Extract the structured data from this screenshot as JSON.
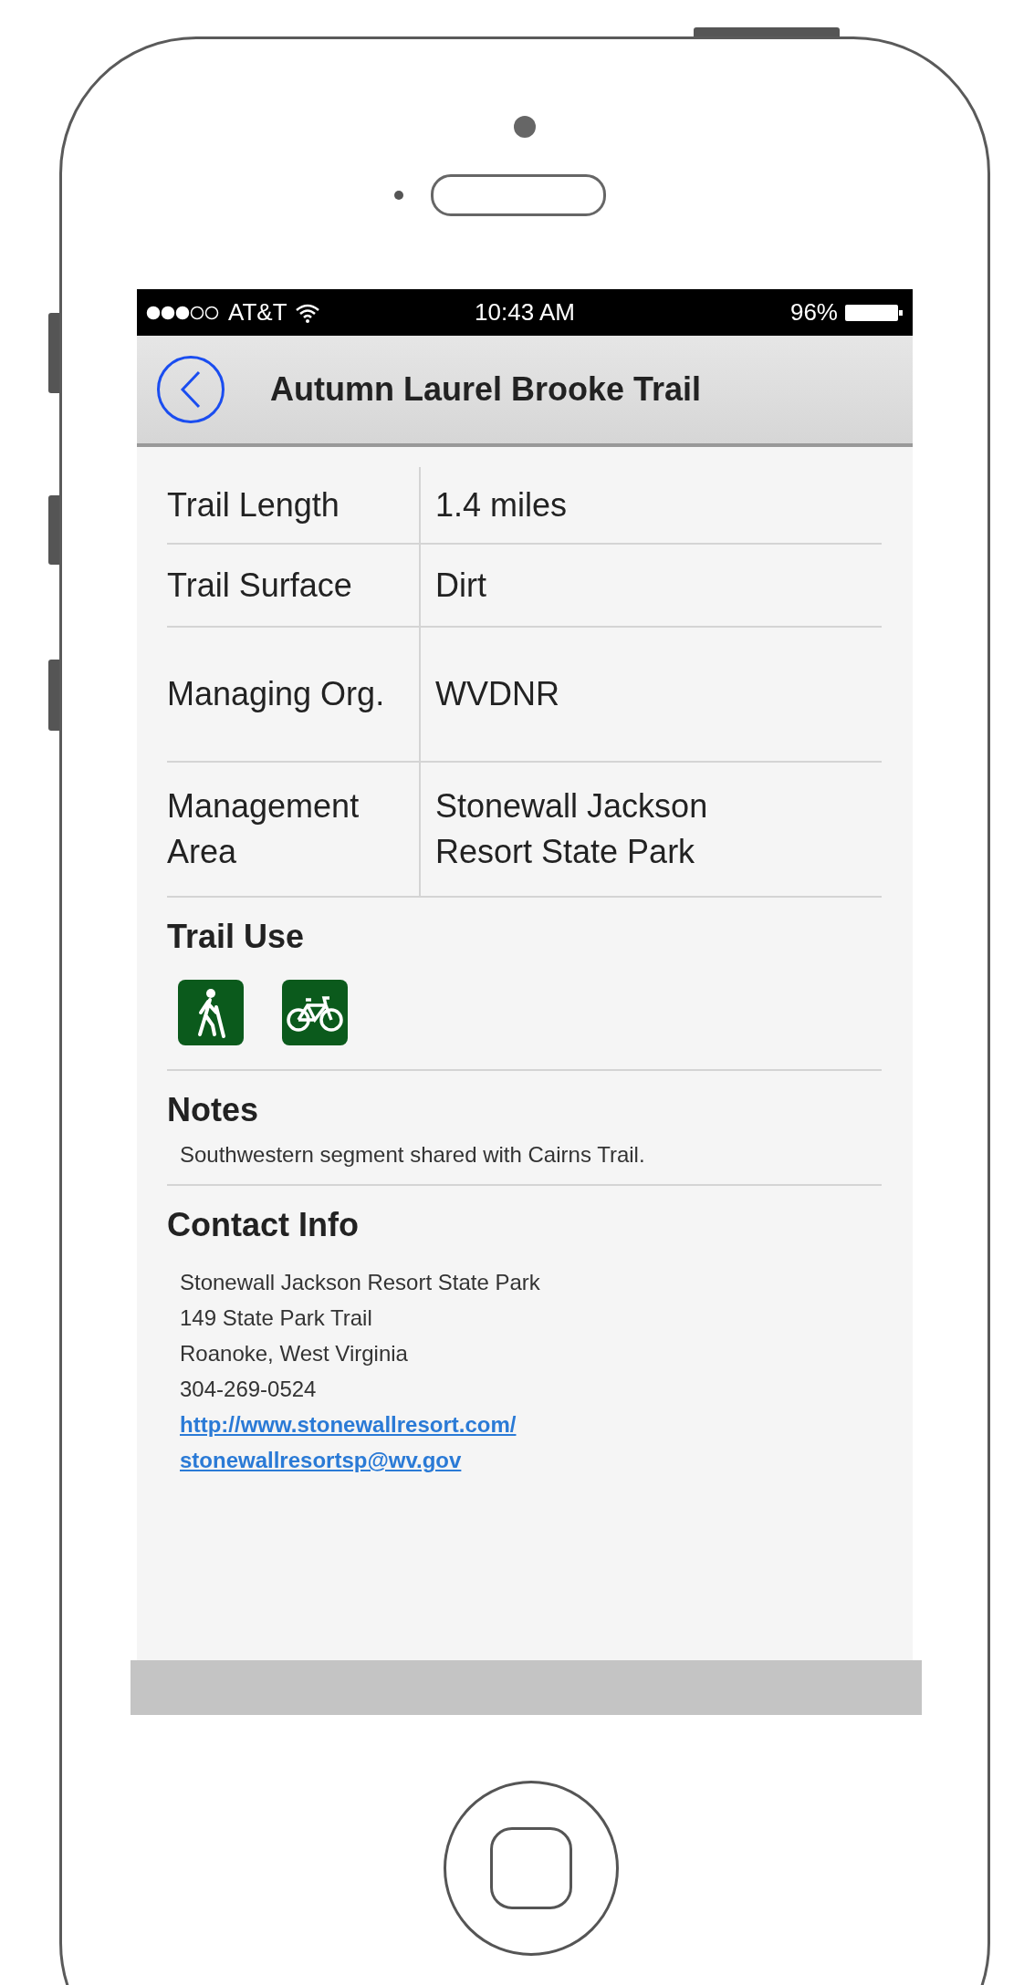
{
  "status_bar": {
    "carrier": "AT&T",
    "time": "10:43 AM",
    "battery": "96%"
  },
  "nav_bar": {
    "title": "Autumn Laurel Brooke Trail"
  },
  "details": [
    {
      "label": "Trail Length",
      "value": "1.4 miles"
    },
    {
      "label": "Trail Surface",
      "value": "Dirt"
    },
    {
      "label": "Managing Org.",
      "value": "WVDNR"
    },
    {
      "label": "Management Area",
      "value": "Stonewall Jackson Resort State Park"
    }
  ],
  "trail_use": {
    "heading": "Trail Use",
    "icons": [
      {
        "kind": "hiking"
      },
      {
        "kind": "biking"
      }
    ]
  },
  "notes": {
    "heading": "Notes",
    "text": "Southwestern segment shared with Cairns Trail."
  },
  "contact": {
    "heading": "Contact Info",
    "lines": [
      {
        "kind": "text",
        "text": "Stonewall Jackson Resort State Park"
      },
      {
        "kind": "text",
        "text": "149 State Park Trail"
      },
      {
        "kind": "text",
        "text": "Roanoke, West Virginia"
      },
      {
        "kind": "text",
        "text": "304-269-0524"
      },
      {
        "kind": "link",
        "text": "http://www.stonewallresort.com/"
      },
      {
        "kind": "link",
        "text": "stonewallresortsp@wv.gov"
      }
    ]
  }
}
